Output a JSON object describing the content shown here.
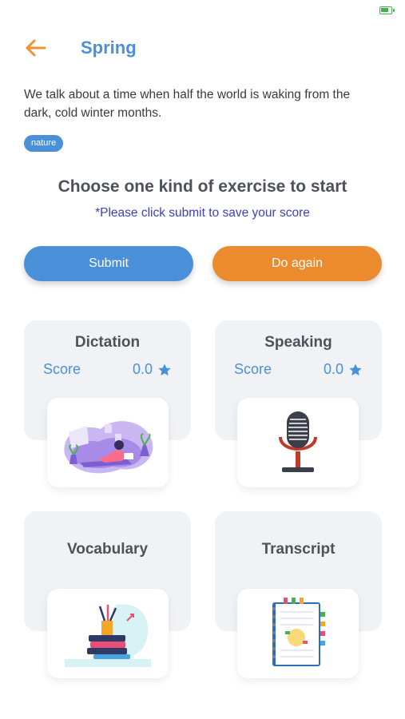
{
  "header": {
    "title": "Spring",
    "back_icon": "arrow-left-icon"
  },
  "lesson": {
    "description": "We talk about a time when half the world is waking from the dark, cold winter months.",
    "tag": "nature"
  },
  "instructions": {
    "heading": "Choose one kind of exercise to start",
    "note": "*Please click submit to save your score"
  },
  "actions": {
    "submit_label": "Submit",
    "again_label": "Do again"
  },
  "exercises": [
    {
      "title": "Dictation",
      "score_label": "Score",
      "score_value": "0.0",
      "icon": "reading-woman-illustration"
    },
    {
      "title": "Speaking",
      "score_label": "Score",
      "score_value": "0.0",
      "icon": "microphone-illustration"
    },
    {
      "title": "Vocabulary",
      "icon": "books-illustration"
    },
    {
      "title": "Transcript",
      "icon": "notebook-illustration"
    }
  ],
  "colors": {
    "accent_blue": "#4a90d9",
    "accent_orange": "#ec8a2e",
    "note_color": "#3b3fbf",
    "card_bg": "#f1f2f6"
  }
}
